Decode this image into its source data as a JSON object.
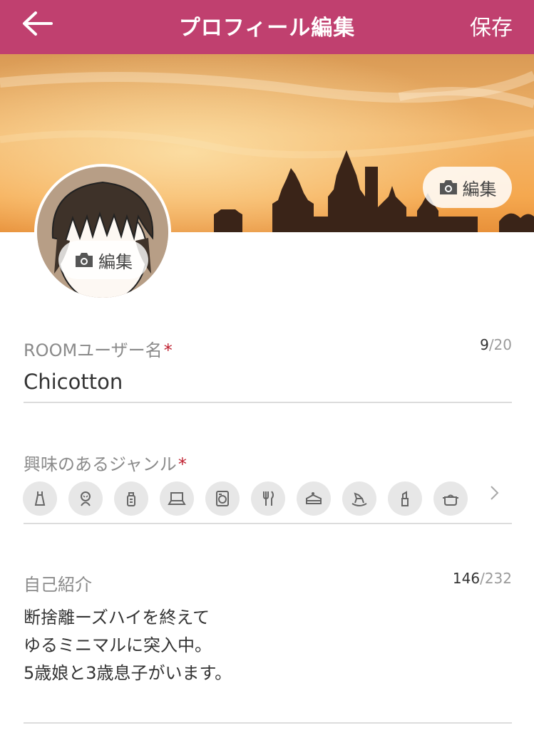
{
  "header": {
    "title": "プロフィール編集",
    "save_label": "保存",
    "back_icon": "arrow-left-icon",
    "color": "#c0406f"
  },
  "cover": {
    "edit_label": "編集",
    "camera_icon": "camera-icon"
  },
  "avatar": {
    "edit_label": "編集",
    "camera_icon": "camera-icon"
  },
  "username": {
    "label": "ROOMユーザー名",
    "required_mark": "*",
    "value": "Chicotton",
    "count_current": "9",
    "count_max": "/20"
  },
  "genres": {
    "label": "興味のあるジャンル",
    "required_mark": "*",
    "items": [
      {
        "icon": "dress-icon"
      },
      {
        "icon": "baby-icon"
      },
      {
        "icon": "baby-bottle-icon"
      },
      {
        "icon": "laptop-icon"
      },
      {
        "icon": "washing-machine-icon"
      },
      {
        "icon": "fork-knife-icon"
      },
      {
        "icon": "cake-icon"
      },
      {
        "icon": "rocking-horse-icon"
      },
      {
        "icon": "lipstick-icon"
      },
      {
        "icon": "pot-icon"
      }
    ],
    "more_icon": "chevron-right-icon"
  },
  "intro": {
    "label": "自己紹介",
    "count_current": "146",
    "count_max": "/232",
    "lines": [
      "断捨離ーズハイを終えて",
      "ゆるミニマルに突入中。",
      "5歳娘と3歳息子がいます。"
    ]
  }
}
